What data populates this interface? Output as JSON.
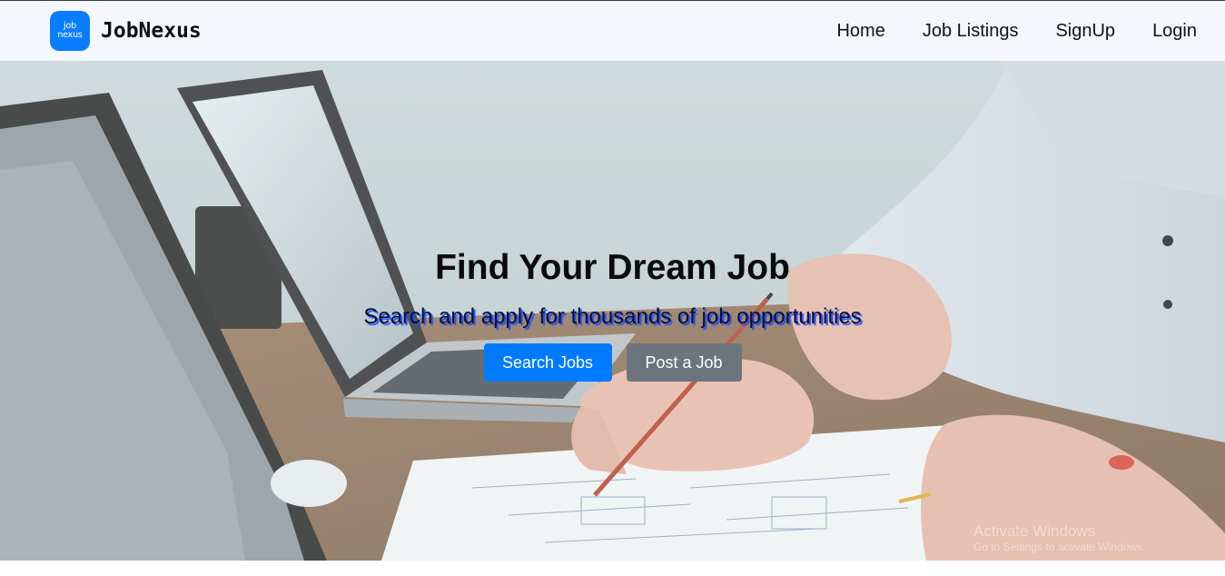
{
  "brand": {
    "logo_line1": "job",
    "logo_line2": "nexus",
    "name": "JobNexus"
  },
  "nav": {
    "items": [
      {
        "label": "Home"
      },
      {
        "label": "Job Listings"
      },
      {
        "label": "SignUp"
      },
      {
        "label": "Login"
      }
    ]
  },
  "hero": {
    "title": "Find Your Dream Job",
    "subtitle": "Search and apply for thousands of job opportunities",
    "primary_button": "Search Jobs",
    "secondary_button": "Post a Job",
    "background_image": "office-desk-laptops-photo"
  },
  "watermark": {
    "title": "Activate Windows",
    "subtitle": "Go to Settings to activate Windows."
  },
  "colors": {
    "primary": "#007bff",
    "secondary": "#6c757d",
    "logo": "#0a7cff",
    "navbar_bg": "#f4f8fd",
    "subtitle_shadow": "#1a4eff"
  }
}
